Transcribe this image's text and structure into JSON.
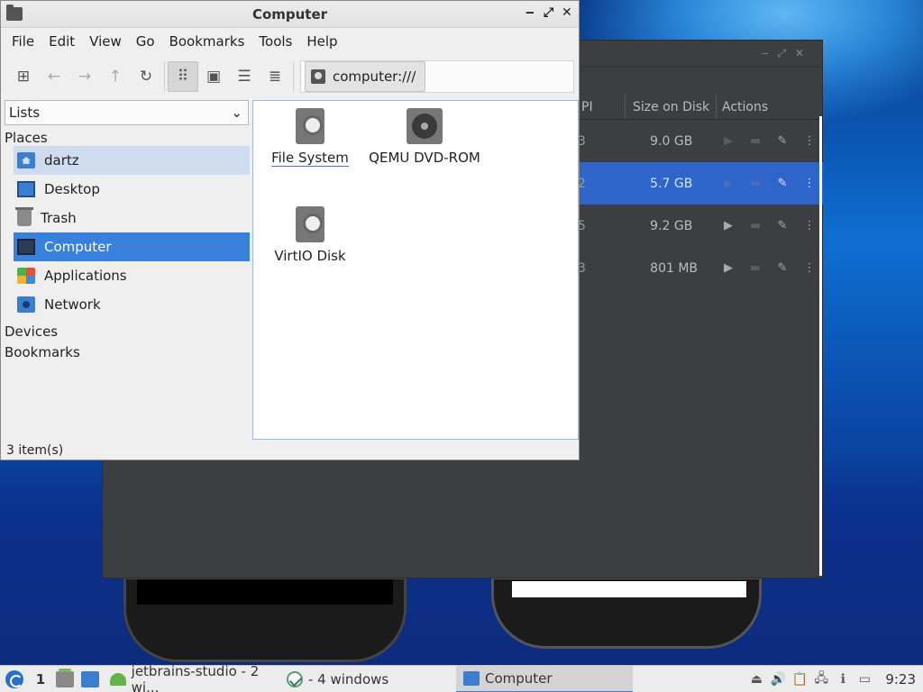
{
  "file_manager": {
    "title": "Computer",
    "window_buttons": [
      "‒",
      "⤢",
      "✕"
    ],
    "menu": [
      "File",
      "Edit",
      "View",
      "Go",
      "Bookmarks",
      "Tools",
      "Help"
    ],
    "location": "computer:///",
    "side_pane_mode": "Lists",
    "places_header": "Places",
    "places": [
      {
        "label": "dartz",
        "icon": "home-folder-icon"
      },
      {
        "label": "Desktop",
        "icon": "desktop-icon"
      },
      {
        "label": "Trash",
        "icon": "trash-icon"
      },
      {
        "label": "Computer",
        "icon": "computer-icon"
      },
      {
        "label": "Applications",
        "icon": "applications-icon"
      },
      {
        "label": "Network",
        "icon": "network-icon"
      }
    ],
    "devices_header": "Devices",
    "bookmarks_header": "Bookmarks",
    "items": [
      {
        "label": "File System",
        "icon": "harddisk-icon"
      },
      {
        "label": "QEMU DVD-ROM",
        "icon": "optical-drive-icon"
      },
      {
        "label": "VirtIO Disk",
        "icon": "harddisk-icon"
      }
    ],
    "status": "3 item(s)"
  },
  "background_app": {
    "columns": [
      "PI",
      "Size on Disk",
      "Actions"
    ],
    "rows": [
      {
        "api": "3",
        "size": "9.0 GB",
        "selected": false,
        "play_enabled": false,
        "folder_enabled": false
      },
      {
        "api": "2",
        "size": "5.7 GB",
        "selected": true,
        "play_enabled": false,
        "folder_enabled": false
      },
      {
        "api": "5",
        "size": "9.2 GB",
        "selected": false,
        "play_enabled": true,
        "folder_enabled": false
      },
      {
        "api": "3",
        "size": "801 MB",
        "selected": false,
        "play_enabled": true,
        "folder_enabled": false
      }
    ]
  },
  "taskbar": {
    "desktop_number": "1",
    "tasks": [
      {
        "label": "jetbrains-studio - 2 wi...",
        "icon": "android-studio-icon"
      },
      {
        "label": "- 4 windows",
        "icon": "studio-icon"
      },
      {
        "label": "Computer",
        "icon": "file-manager-icon"
      }
    ],
    "clock": "9:23"
  }
}
